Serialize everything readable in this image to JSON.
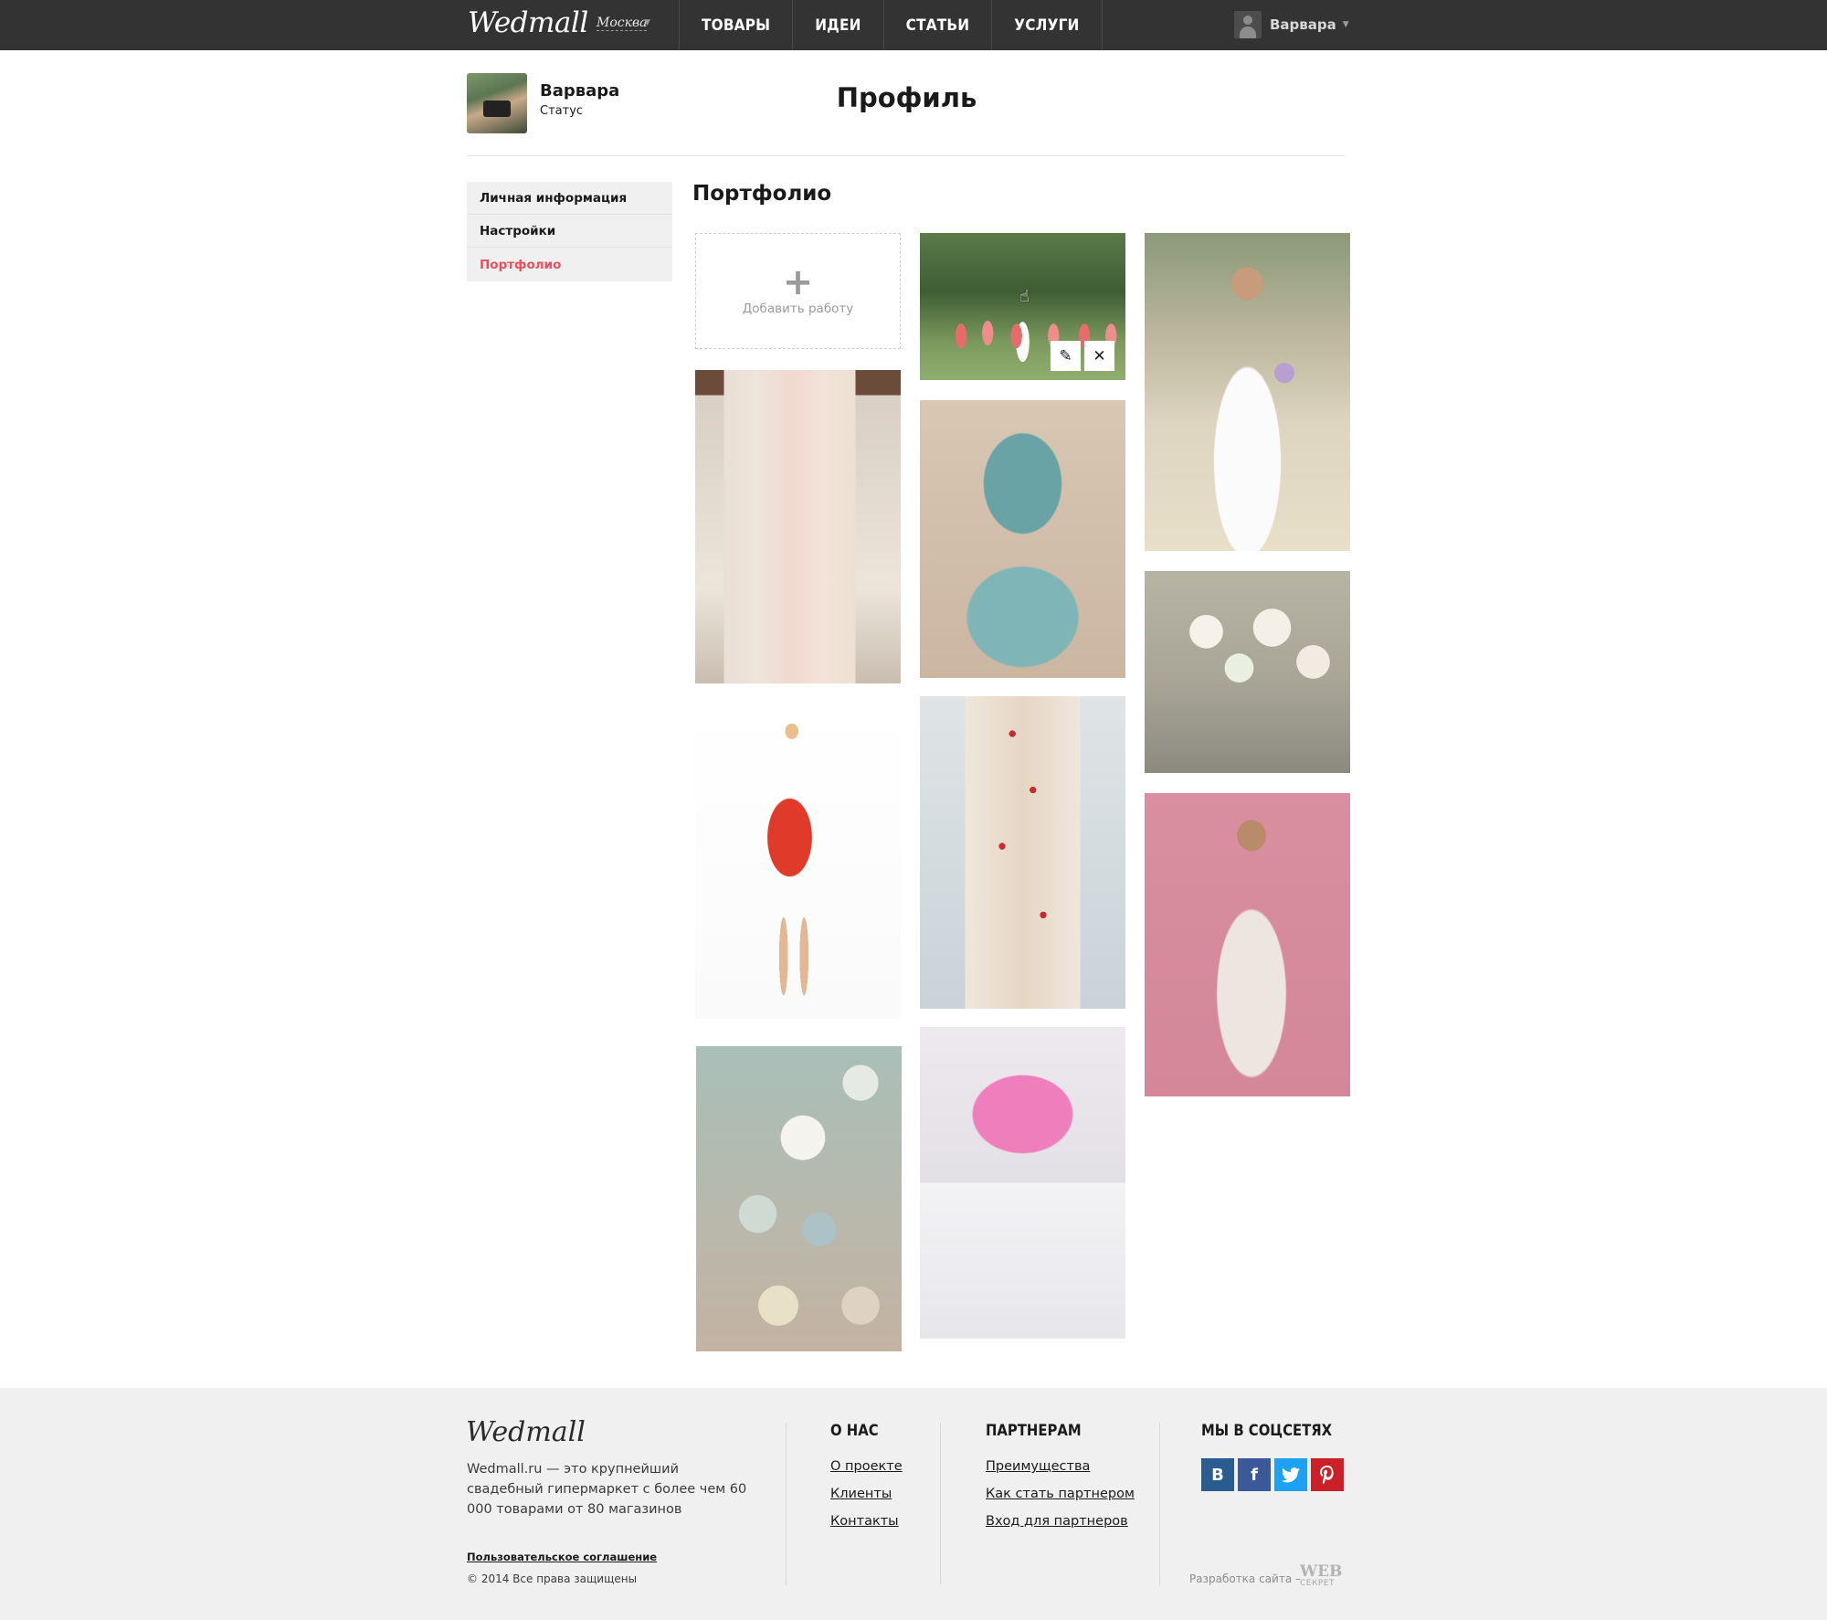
{
  "topbar": {
    "logo": "Wedmall",
    "city": "Москва",
    "nav": [
      "ТОВАРЫ",
      "ИДЕИ",
      "СТАТЬИ",
      "УСЛУГИ"
    ],
    "user_name": "Варвара"
  },
  "profile": {
    "name": "Варвара",
    "status": "Статус",
    "page_title": "Профиль"
  },
  "sidebar": {
    "items": [
      {
        "label": "Личная информация",
        "active": false
      },
      {
        "label": "Настройки",
        "active": false
      },
      {
        "label": "Портфолио",
        "active": true
      }
    ]
  },
  "portfolio": {
    "title": "Портфолио",
    "add_label": "Добавить работу",
    "tiles": [
      {
        "name": "bridesmaids-photo",
        "hover_actions": true
      },
      {
        "name": "bride-field-photo"
      },
      {
        "name": "dresses-rack-photo"
      },
      {
        "name": "teal-dress-photo"
      },
      {
        "name": "flower-centerpiece-photo"
      },
      {
        "name": "red-dress-photo"
      },
      {
        "name": "naked-cake-photo"
      },
      {
        "name": "lace-back-dress-photo"
      },
      {
        "name": "paper-lanterns-photo"
      },
      {
        "name": "peony-cake-photo"
      }
    ],
    "edit_icon": "pencil-icon",
    "delete_icon": "close-icon"
  },
  "footer": {
    "logo": "Wedmall",
    "about": "Wedmall.ru — это крупнейший свадебный гипермаркет с более чем 60 000 товарами от 80 магазинов",
    "agreement": "Пользовательское соглашение",
    "copyright": "© 2014 Все права защищены",
    "about_col": {
      "title": "О НАС",
      "links": [
        "О проекте",
        "Клиенты",
        "Контакты"
      ]
    },
    "partners_col": {
      "title": "ПАРТНЕРАМ",
      "links": [
        "Преимущества",
        "Как стать партнером",
        "Вход для партнеров"
      ]
    },
    "social_col": {
      "title": "МЫ В СОЦСЕТЯХ",
      "networks": [
        {
          "glyph": "В",
          "icon": "vk-icon",
          "color": "#2b5c8f"
        },
        {
          "glyph": "f",
          "icon": "facebook-icon",
          "color": "#3b5998"
        },
        {
          "glyph": "t",
          "icon": "twitter-icon",
          "color": "#1da1f2"
        },
        {
          "glyph": "P",
          "icon": "pinterest-icon",
          "color": "#cb2027"
        }
      ]
    },
    "developer_label": "Разработка сайта  –",
    "developer_logo": "WEB",
    "developer_logo_sub": "СЕКРЕТ"
  },
  "colors": {
    "topbar": "#333333",
    "accent": "#e8505b",
    "sidebar_bg": "#f0f0f0",
    "footer_bg": "#f0f0f0"
  }
}
